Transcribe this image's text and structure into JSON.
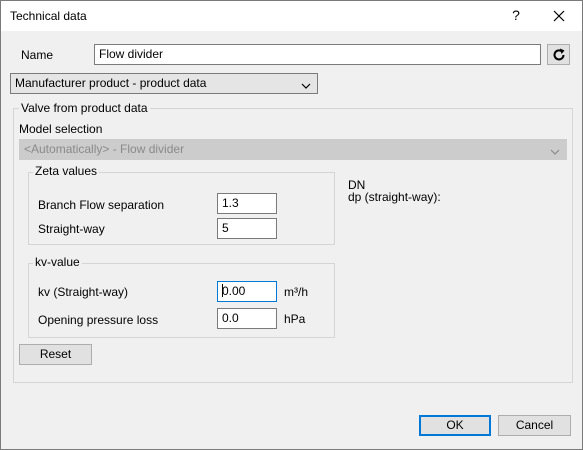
{
  "window": {
    "title": "Technical data",
    "help_label": "?"
  },
  "name_row": {
    "label": "Name",
    "value": "Flow divider"
  },
  "source_select": {
    "value": "Manufacturer product - product data"
  },
  "valve_group": {
    "title": "Valve from product data",
    "model_selection_label": "Model selection",
    "model_selection_value": "<Automatically> - Flow divider"
  },
  "zeta_group": {
    "title": "Zeta values",
    "branch_label": "Branch Flow separation",
    "branch_value": "1.3",
    "straight_label": "Straight-way",
    "straight_value": "5"
  },
  "kv_group": {
    "title": "kv-value",
    "kv_label": "kv (Straight-way)",
    "kv_value": "0.00",
    "kv_unit": "m³/h",
    "pressure_label": "Opening pressure loss",
    "pressure_value": "0.0",
    "pressure_unit": "hPa"
  },
  "info": {
    "dn_label": "DN",
    "dp_label": "dp (straight-way):"
  },
  "buttons": {
    "reset": "Reset",
    "ok": "OK",
    "cancel": "Cancel"
  },
  "icons": {
    "close": "close-icon",
    "refresh": "refresh-icon",
    "dropdown": "chevron-down-icon"
  }
}
